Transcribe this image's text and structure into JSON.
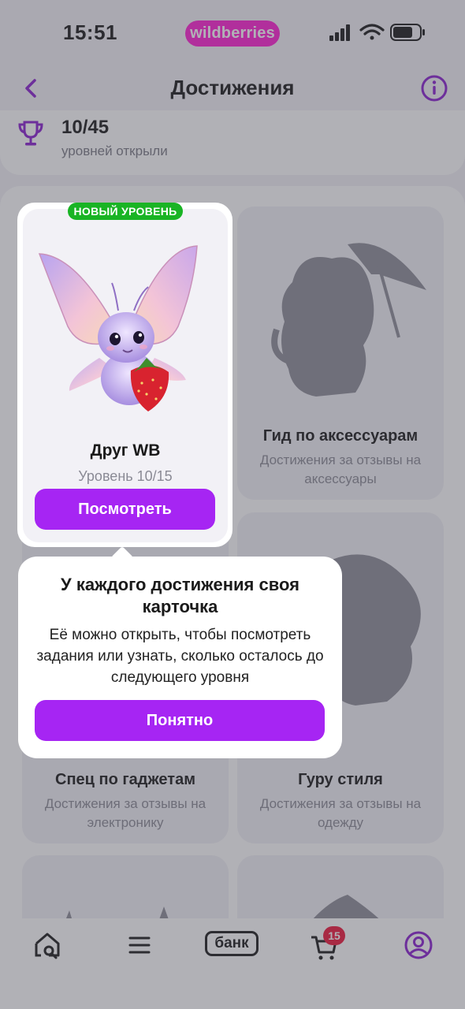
{
  "status_bar": {
    "time": "15:51",
    "brand": "wildberries"
  },
  "header": {
    "title": "Достижения"
  },
  "summary": {
    "count": "10/45",
    "label": "уровней открыли"
  },
  "achievements": [
    {
      "title": "Друг WB",
      "level": "Уровень 10/15",
      "badge": "НОВЫЙ УРОВЕНЬ",
      "button_label": "Посмотреть"
    },
    {
      "title": "Гид по аксессуарам",
      "subtitle": "Достижения за отзывы на аксессуары"
    },
    {
      "title": "Спец по гаджетам",
      "subtitle": "Достижения за отзывы на электронику"
    },
    {
      "title": "Гуру стиля",
      "subtitle": "Достижения за отзывы на одежду"
    }
  ],
  "tooltip": {
    "title": "У каждого достижения своя карточка",
    "body": "Её можно открыть, чтобы посмотреть задания или узнать, сколько осталось до следующего уровня",
    "button_label": "Понятно"
  },
  "tab_bar": {
    "items": [
      {
        "name": "home",
        "icon": "home-search-icon"
      },
      {
        "name": "catalog",
        "icon": "menu-icon"
      },
      {
        "name": "bank",
        "label": "банк"
      },
      {
        "name": "cart",
        "icon": "cart-icon",
        "badge": "15"
      },
      {
        "name": "profile",
        "icon": "profile-icon"
      }
    ]
  },
  "colors": {
    "accent": "#a625f3",
    "brand": "#ff1fd2",
    "new_badge": "#19b424",
    "cart_badge": "#f0173c"
  }
}
